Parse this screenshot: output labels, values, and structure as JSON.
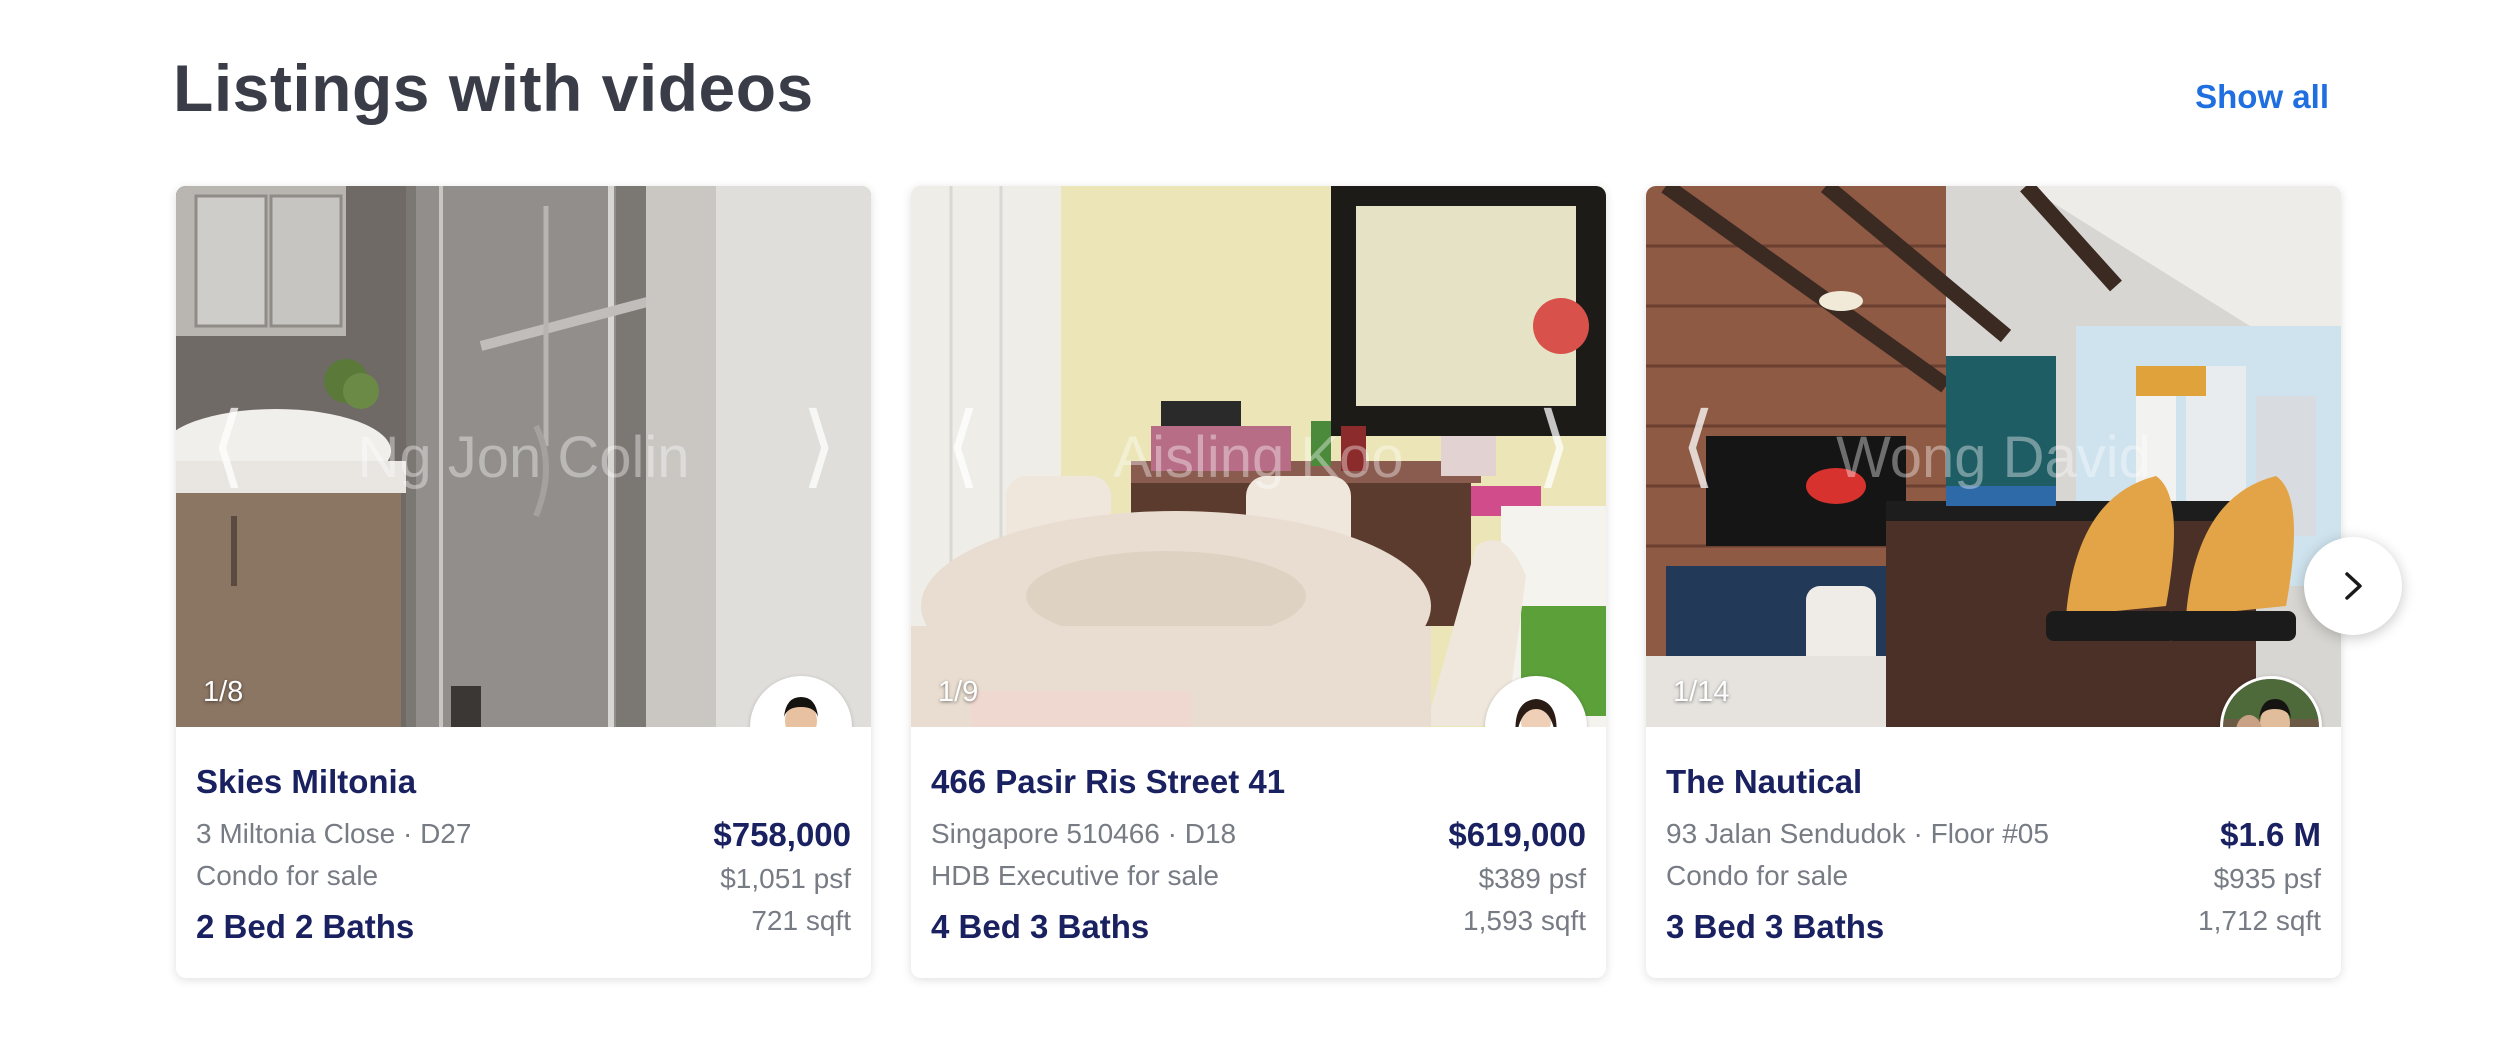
{
  "section": {
    "title": "Listings with videos",
    "show_all_label": "Show all"
  },
  "carousel": {
    "next_icon": "chevron-right-icon",
    "prev_arrow_icon": "chevron-left-icon"
  },
  "listings": [
    {
      "watermark": "Ng Jon Colin",
      "counter": "1/8",
      "name": "Skies Miltonia",
      "address": "3 Miltonia Close · D27",
      "property_type": "Condo for sale",
      "beds_baths": "2 Bed 2 Baths",
      "price": "$758,000",
      "psf": "$1,051 psf",
      "sqft": "721 sqft"
    },
    {
      "watermark": "Aisling Koo",
      "counter": "1/9",
      "name": "466 Pasir Ris Street 41",
      "address": "Singapore 510466 · D18",
      "property_type": "HDB Executive for sale",
      "beds_baths": "4 Bed 3 Baths",
      "price": "$619,000",
      "psf": "$389 psf",
      "sqft": "1,593 sqft"
    },
    {
      "watermark": "Wong David",
      "counter": "1/14",
      "name": "The Nautical",
      "address": "93 Jalan Sendudok · Floor #05",
      "property_type": "Condo for sale",
      "beds_baths": "3 Bed 3 Baths",
      "price": "$1.6 M",
      "psf": "$935 psf",
      "sqft": "1,712 sqft"
    }
  ],
  "colors": {
    "title": "#3a3d48",
    "link": "#1f6fe0",
    "navy": "#1a2160",
    "muted": "#777b84"
  }
}
